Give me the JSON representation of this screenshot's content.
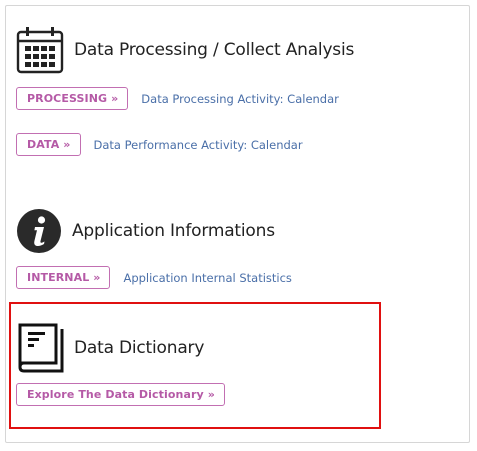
{
  "sections": {
    "processing": {
      "title": "Data Processing / Collect Analysis",
      "icon": "calendar-icon",
      "rows": [
        {
          "button": "PROCESSING »",
          "link": "Data Processing Activity: Calendar"
        },
        {
          "button": "DATA »",
          "link": "Data Performance Activity: Calendar"
        }
      ]
    },
    "application": {
      "title": "Application Informations",
      "icon": "info-icon",
      "rows": [
        {
          "button": "INTERNAL »",
          "link": "Application Internal Statistics"
        }
      ]
    },
    "dictionary": {
      "title": "Data Dictionary",
      "icon": "book-icon",
      "button": "Explore The Data Dictionary »"
    }
  },
  "colors": {
    "accent": "#b55aa6",
    "link": "#4a6fa8",
    "highlight": "#e01010"
  }
}
